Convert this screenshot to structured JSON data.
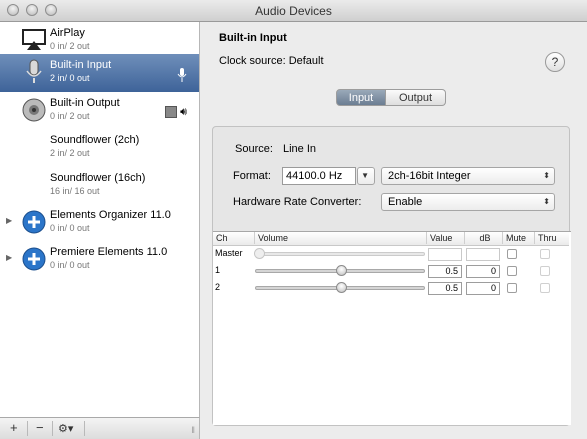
{
  "window": {
    "title": "Audio Devices"
  },
  "sidebar": {
    "devices": [
      {
        "name": "AirPlay",
        "channels": "0 in/ 2 out",
        "icon": "airplay-icon"
      },
      {
        "name": "Built-in Input",
        "channels": "2 in/ 0 out",
        "icon": "microphone-icon",
        "selected": true
      },
      {
        "name": "Built-in Output",
        "channels": "0 in/ 2 out",
        "icon": "speaker-icon"
      },
      {
        "name": "Soundflower (2ch)",
        "channels": "2 in/ 2 out"
      },
      {
        "name": "Soundflower (16ch)",
        "channels": "16 in/ 16 out"
      },
      {
        "name": "Elements Organizer 11.0",
        "channels": "0 in/ 0 out",
        "icon": "plus-circle-icon"
      },
      {
        "name": "Premiere Elements 11.0",
        "channels": "0 in/ 0 out",
        "icon": "plus-circle-icon"
      }
    ],
    "toolbar": {
      "add": "+",
      "remove": "−",
      "action": "⚙▾"
    }
  },
  "detail": {
    "device_name": "Built-in Input",
    "clock_source": "Clock source: Default",
    "help": "?",
    "tabs": [
      {
        "label": "Input",
        "active": true
      },
      {
        "label": "Output",
        "active": false
      }
    ],
    "source_label": "Source:",
    "source_value": "Line In",
    "format_label": "Format:",
    "format_rate": "44100.0 Hz",
    "format_type": "2ch-16bit Integer",
    "hrc_label": "Hardware Rate Converter:",
    "hrc_value": "Enable",
    "table": {
      "columns": [
        "Ch",
        "Volume",
        "Value",
        "dB",
        "Mute",
        "Thru"
      ],
      "rows": [
        {
          "ch": "Master",
          "volume": 0,
          "value": "",
          "db": "",
          "mute": false,
          "thru": false
        },
        {
          "ch": "1",
          "volume": 0.5,
          "value": "0.5",
          "db": "0",
          "mute": false,
          "thru": false
        },
        {
          "ch": "2",
          "volume": 0.5,
          "value": "0.5",
          "db": "0",
          "mute": false,
          "thru": false
        }
      ]
    }
  },
  "colors": {
    "selection": "#4a6ea3",
    "window_bg": "#ececec"
  }
}
